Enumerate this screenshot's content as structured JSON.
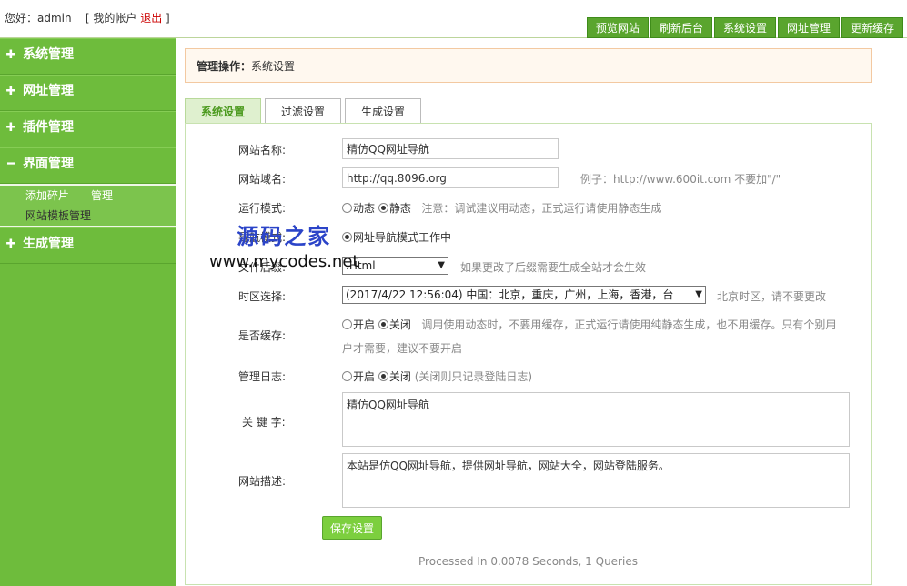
{
  "header": {
    "greeting": "您好：admin",
    "account_open": "[ 我的帐户",
    "logout": "退出",
    "account_close": "]",
    "nav": [
      "预览网站",
      "刷新后台",
      "系统设置",
      "网址管理",
      "更新缓存"
    ]
  },
  "sidebar": {
    "groups": [
      {
        "icon": "plus-icon",
        "label": "系统管理"
      },
      {
        "icon": "plus-icon",
        "label": "网址管理"
      },
      {
        "icon": "plus-icon",
        "label": "插件管理"
      },
      {
        "icon": "minus-icon",
        "label": "界面管理"
      },
      {
        "icon": "plus-icon",
        "label": "生成管理"
      }
    ],
    "subitems": {
      "add_fragment": "添加碎片",
      "manage": "管理",
      "template": "网站模板管理"
    }
  },
  "main": {
    "op_label": "管理操作：",
    "op_value": "系统设置",
    "tabs": [
      "系统设置",
      "过滤设置",
      "生成设置"
    ],
    "form": {
      "site_name": {
        "label": "网站名称:",
        "value": "精仿QQ网址导航"
      },
      "site_domain": {
        "label": "网站域名:",
        "value": "http://qq.8096.org",
        "hint": "例子：http://www.600it.com   不要加\"/\""
      },
      "run_mode": {
        "label": "运行模式:",
        "opt1": "动态",
        "opt2": "静态",
        "hint": "注意：调试建议用动态，正式运行请使用静态生成"
      },
      "nav_mode": {
        "label": "导航模式:",
        "opt1": "网址导航模式工作中"
      },
      "file_ext": {
        "label": "文件后缀:",
        "value": ".Html",
        "hint": "如果更改了后缀需要生成全站才会生效"
      },
      "timezone": {
        "label": "时区选择:",
        "value": "(2017/4/22 12:56:04) 中国：北京，重庆，广州，上海，香港，台",
        "hint": "北京时区，请不要更改"
      },
      "cache": {
        "label": "是否缓存:",
        "opt1": "开启",
        "opt2": "关闭",
        "hint1": "调用使用动态时，不要用缓存，正式运行请使用纯静态生成，也不用缓存。只有个别用",
        "hint2": "户才需要，建议不要开启"
      },
      "admin_log": {
        "label": "管理日志:",
        "opt1": "开启",
        "opt2": "关闭",
        "hint": "(关闭则只记录登陆日志)"
      },
      "keywords": {
        "label": "关 键 字:",
        "value": "精仿QQ网址导航"
      },
      "description": {
        "label": "网站描述:",
        "value": "本站是仿QQ网址导航，提供网址导航，网站大全，网站登陆服务。"
      }
    },
    "save_label": "保存设置",
    "footer": "Processed In 0.0078 Seconds, 1 Queries"
  },
  "watermark": {
    "line1": "源码之家",
    "line2": "www.mycodes.net"
  },
  "colors": {
    "accent": "#6ebc3c",
    "nav_button": "#5aa52e",
    "logout": "#cc0000",
    "tab_active": "#4c9a1f"
  }
}
